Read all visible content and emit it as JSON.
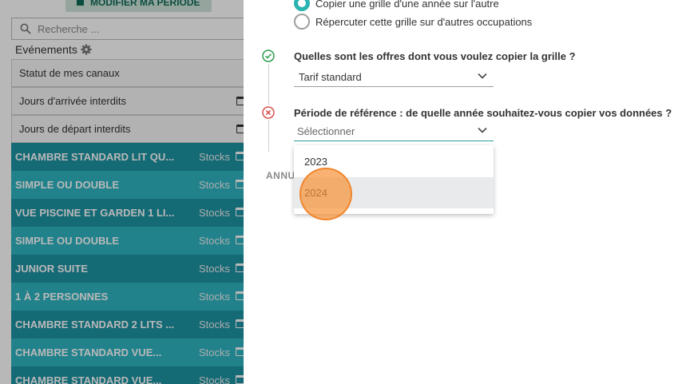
{
  "background": {
    "modify_period_label": "MODIFIER MA PÉRIODE",
    "search_placeholder": "Recherche ...",
    "events_label": "Evénements",
    "plain_rows": [
      {
        "label": "Statut de mes canaux"
      },
      {
        "label": "Jours d'arrivée interdits"
      },
      {
        "label": "Jours de départ interdits"
      }
    ],
    "room_rows": [
      {
        "label": "CHAMBRE STANDARD LIT QU...",
        "stocks": "Stocks"
      },
      {
        "label": "SIMPLE OU DOUBLE",
        "stocks": "Stocks"
      },
      {
        "label": "VUE PISCINE ET GARDEN 1 LI...",
        "stocks": "Stocks"
      },
      {
        "label": "SIMPLE OU DOUBLE",
        "stocks": "Stocks"
      },
      {
        "label": "JUNIOR SUITE",
        "stocks": "Stocks"
      },
      {
        "label": "1 À 2 PERSONNES",
        "stocks": "Stocks"
      },
      {
        "label": "CHAMBRE STANDARD 2 LITS ...",
        "stocks": "Stocks"
      },
      {
        "label": "CHAMBRE STANDARD VUE...",
        "stocks": "Stocks"
      },
      {
        "label": "CHAMBRE STANDARD VUE...",
        "stocks": "Stocks"
      }
    ]
  },
  "panel": {
    "radio_options": [
      {
        "label": "Copier une grille d'une année sur l'autre",
        "selected": true
      },
      {
        "label": "Répercuter cette grille sur d'autres occupations",
        "selected": false
      }
    ],
    "step_offers": {
      "question": "Quelles sont les offres dont vous voulez copier la grille ?",
      "value": "Tarif standard",
      "status": "done"
    },
    "step_period": {
      "question": "Période de référence : de quelle année souhaitez-vous copier vos données ?",
      "placeholder": "Sélectionner",
      "status": "error"
    },
    "cancel_label": "ANNU",
    "dropdown_options": [
      "2023",
      "2024"
    ],
    "hovered_option": "2024",
    "colors": {
      "accent": "#2bb3b1",
      "success": "#2e9e4f",
      "error": "#d9534f",
      "teal_dark": "#1c93a3",
      "teal_light": "#2eb5c2"
    }
  }
}
